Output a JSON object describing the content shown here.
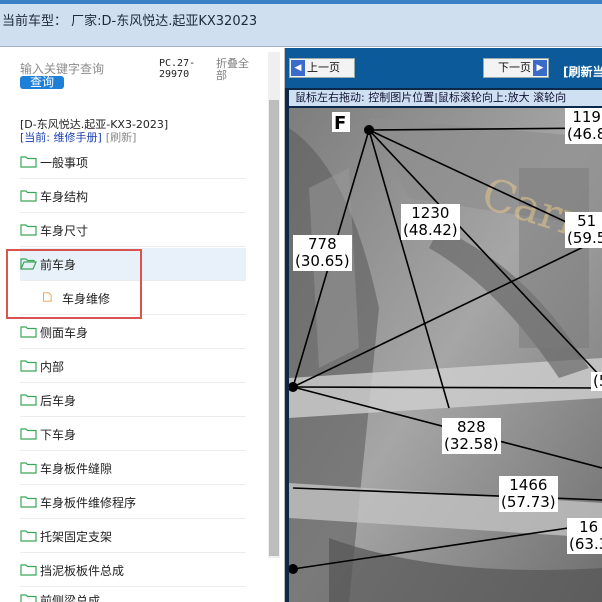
{
  "header": {
    "title": "当前车型： 厂家:D-东风悦达.起亚KX32023"
  },
  "sidebar": {
    "search_placeholder": "输入关键字查询",
    "search_button": "查询",
    "pc_code": "PC.27-29970",
    "collapse_all": "折叠全部",
    "vehicle_path": "[D-东风悦达.起亚-KX3-2023]",
    "current_prefix": "[当前: 维修手册]",
    "refresh": "[刷新]",
    "items": [
      {
        "label": "一般事项"
      },
      {
        "label": "车身结构"
      },
      {
        "label": "车身尺寸"
      },
      {
        "label": "前车身"
      },
      {
        "label": "车身维修"
      },
      {
        "label": "侧面车身"
      },
      {
        "label": "内部"
      },
      {
        "label": "后车身"
      },
      {
        "label": "下车身"
      },
      {
        "label": "车身板件缝隙"
      },
      {
        "label": "车身板件维修程序"
      },
      {
        "label": "托架固定支架"
      },
      {
        "label": "挡泥板板件总成"
      },
      {
        "label": "前侧梁总成"
      }
    ]
  },
  "viewer": {
    "prev_label": "上一页",
    "next_label": "下一页",
    "refresh_label": "[刷新当",
    "hint": "鼠标左右拖动: 控制图片位置|鼠标滚轮向上:放大  滚轮向",
    "figure": {
      "letter": "F",
      "watermark": "Carr",
      "labels": [
        {
          "top": "119",
          "bottom": "(46.8"
        },
        {
          "top": "1230",
          "bottom": "(48.42)"
        },
        {
          "top": "51",
          "bottom": "(59.5"
        },
        {
          "top": "778",
          "bottom": "(30.65)"
        },
        {
          "top": "828",
          "bottom": "(32.58)"
        },
        {
          "top": "1466",
          "bottom": "(57.73)"
        },
        {
          "top": "16",
          "bottom": "(63.3"
        },
        {
          "top": "",
          "bottom": "(5"
        }
      ]
    }
  },
  "colors": {
    "accent": "#1e7fd8",
    "highlight": "#d9534f",
    "viewer_bg": "#0c5a9a"
  }
}
